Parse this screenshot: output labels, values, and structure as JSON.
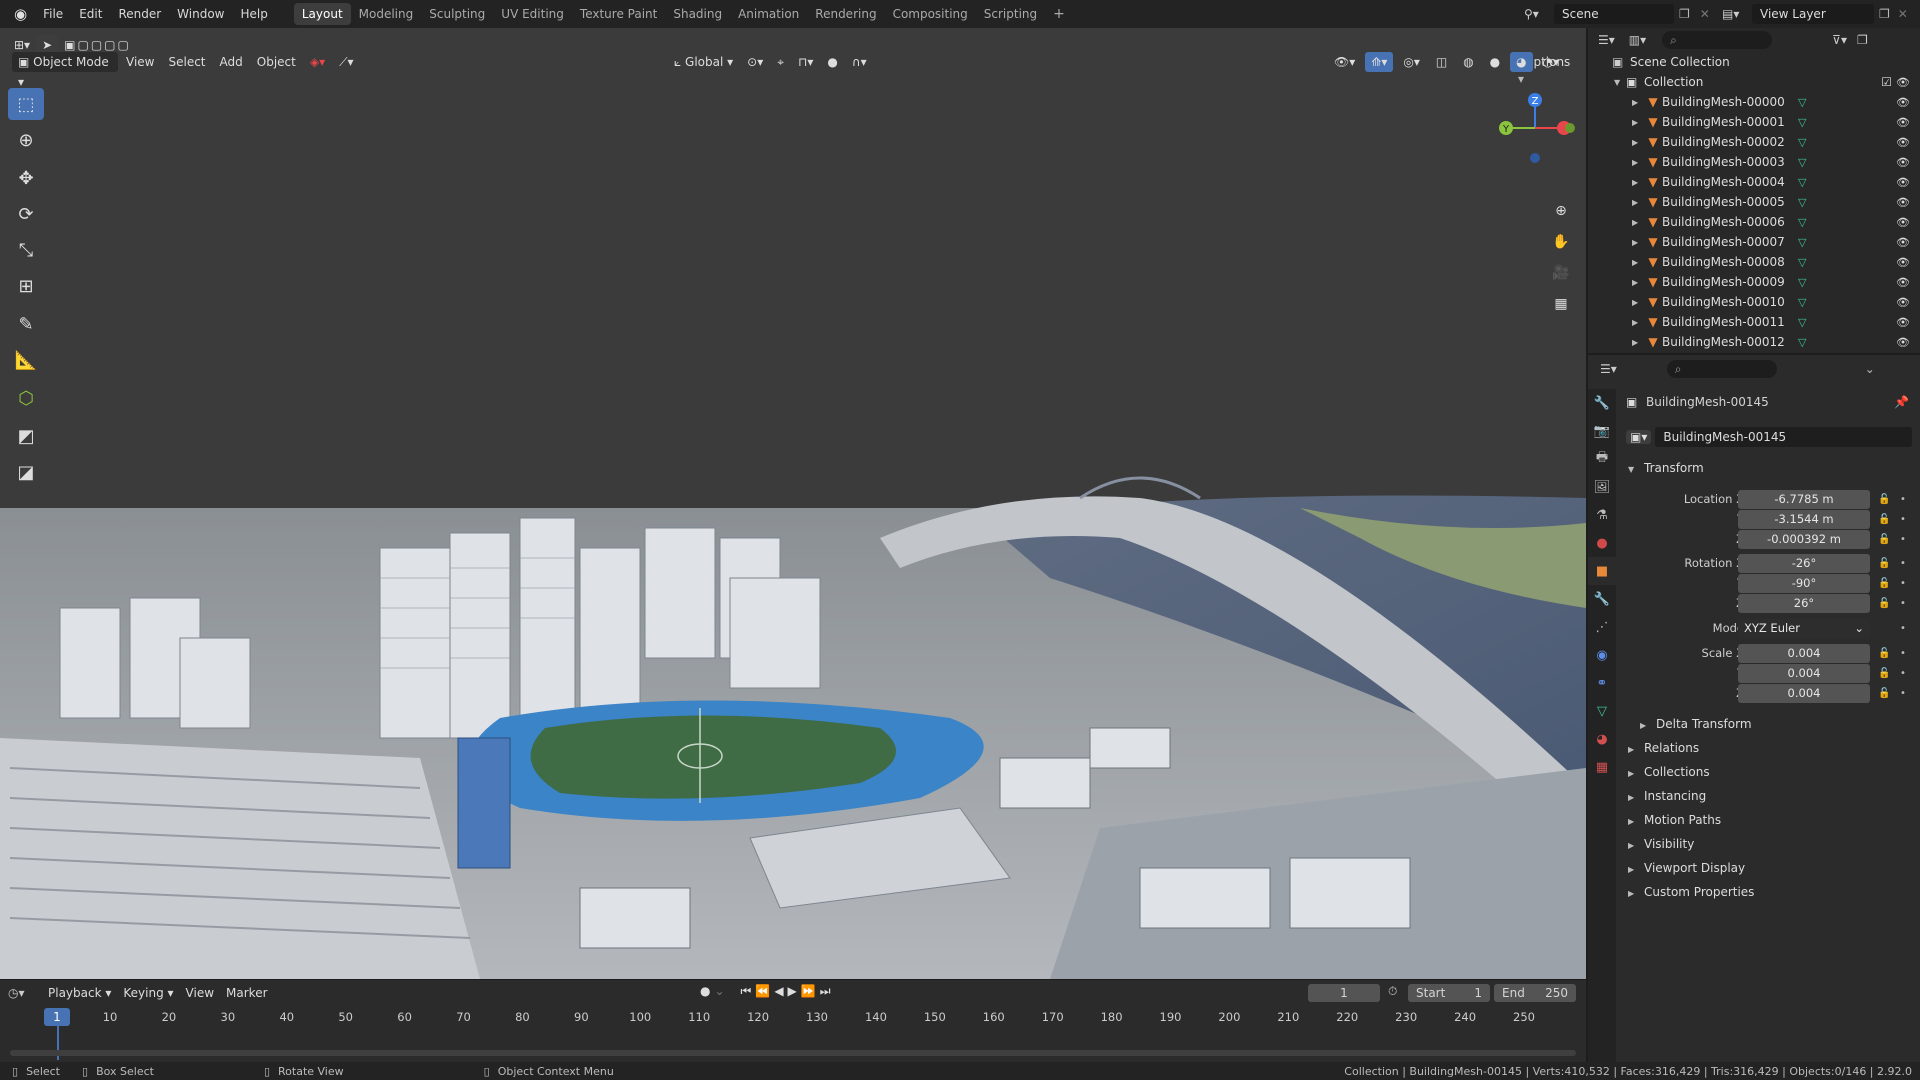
{
  "topbar": {
    "menus": [
      "File",
      "Edit",
      "Render",
      "Window",
      "Help"
    ],
    "workspaces": [
      "Layout",
      "Modeling",
      "Sculpting",
      "UV Editing",
      "Texture Paint",
      "Shading",
      "Animation",
      "Rendering",
      "Compositing",
      "Scripting"
    ],
    "active_workspace": "Layout",
    "scene_name": "Scene",
    "view_layer": "View Layer"
  },
  "viewport": {
    "mode": "Object Mode",
    "menus": [
      "View",
      "Select",
      "Add",
      "Object"
    ],
    "transform_orientation": "Global",
    "options_label": "Options",
    "gizmo_axes": [
      "X",
      "Y",
      "Z"
    ]
  },
  "outliner": {
    "root": "Scene Collection",
    "collection": "Collection",
    "items": [
      "BuildingMesh-00000",
      "BuildingMesh-00001",
      "BuildingMesh-00002",
      "BuildingMesh-00003",
      "BuildingMesh-00004",
      "BuildingMesh-00005",
      "BuildingMesh-00006",
      "BuildingMesh-00007",
      "BuildingMesh-00008",
      "BuildingMesh-00009",
      "BuildingMesh-00010",
      "BuildingMesh-00011",
      "BuildingMesh-00012"
    ]
  },
  "properties": {
    "object_name": "BuildingMesh-00145",
    "datablock_name": "BuildingMesh-00145",
    "transform_label": "Transform",
    "location_label": "Location X",
    "rotation_label": "Rotation X",
    "scale_label": "Scale X",
    "axis_y": "Y",
    "axis_z": "Z",
    "location": [
      "-6.7785 m",
      "-3.1544 m",
      "-0.000392 m"
    ],
    "rotation": [
      "-26°",
      "-90°",
      "26°"
    ],
    "mode_label": "Mode",
    "mode_value": "XYZ Euler",
    "scale": [
      "0.004",
      "0.004",
      "0.004"
    ],
    "delta_transform": "Delta Transform",
    "sections": [
      "Relations",
      "Collections",
      "Instancing",
      "Motion Paths",
      "Visibility",
      "Viewport Display",
      "Custom Properties"
    ]
  },
  "timeline": {
    "menus": [
      "Playback",
      "Keying",
      "View",
      "Marker"
    ],
    "current_frame": "1",
    "start_label": "Start",
    "start": "1",
    "end_label": "End",
    "end": "250",
    "ticks": [
      "10",
      "20",
      "30",
      "40",
      "50",
      "60",
      "70",
      "80",
      "90",
      "100",
      "110",
      "120",
      "130",
      "140",
      "150",
      "160",
      "170",
      "180",
      "190",
      "200",
      "210",
      "220",
      "230",
      "240",
      "250"
    ]
  },
  "statusbar": {
    "select": "Select",
    "box_select": "Box Select",
    "rotate_view": "Rotate View",
    "context_menu": "Object Context Menu",
    "stats": "Collection | BuildingMesh-00145 | Verts:410,532 | Faces:316,429 | Tris:316,429 | Objects:0/146 | 2.92.0"
  },
  "colors": {
    "accent": "#4772b3",
    "mesh": "#e8893a",
    "x_axis": "#e8464b",
    "y_axis": "#8bc43d",
    "z_axis": "#3b7ee8"
  }
}
